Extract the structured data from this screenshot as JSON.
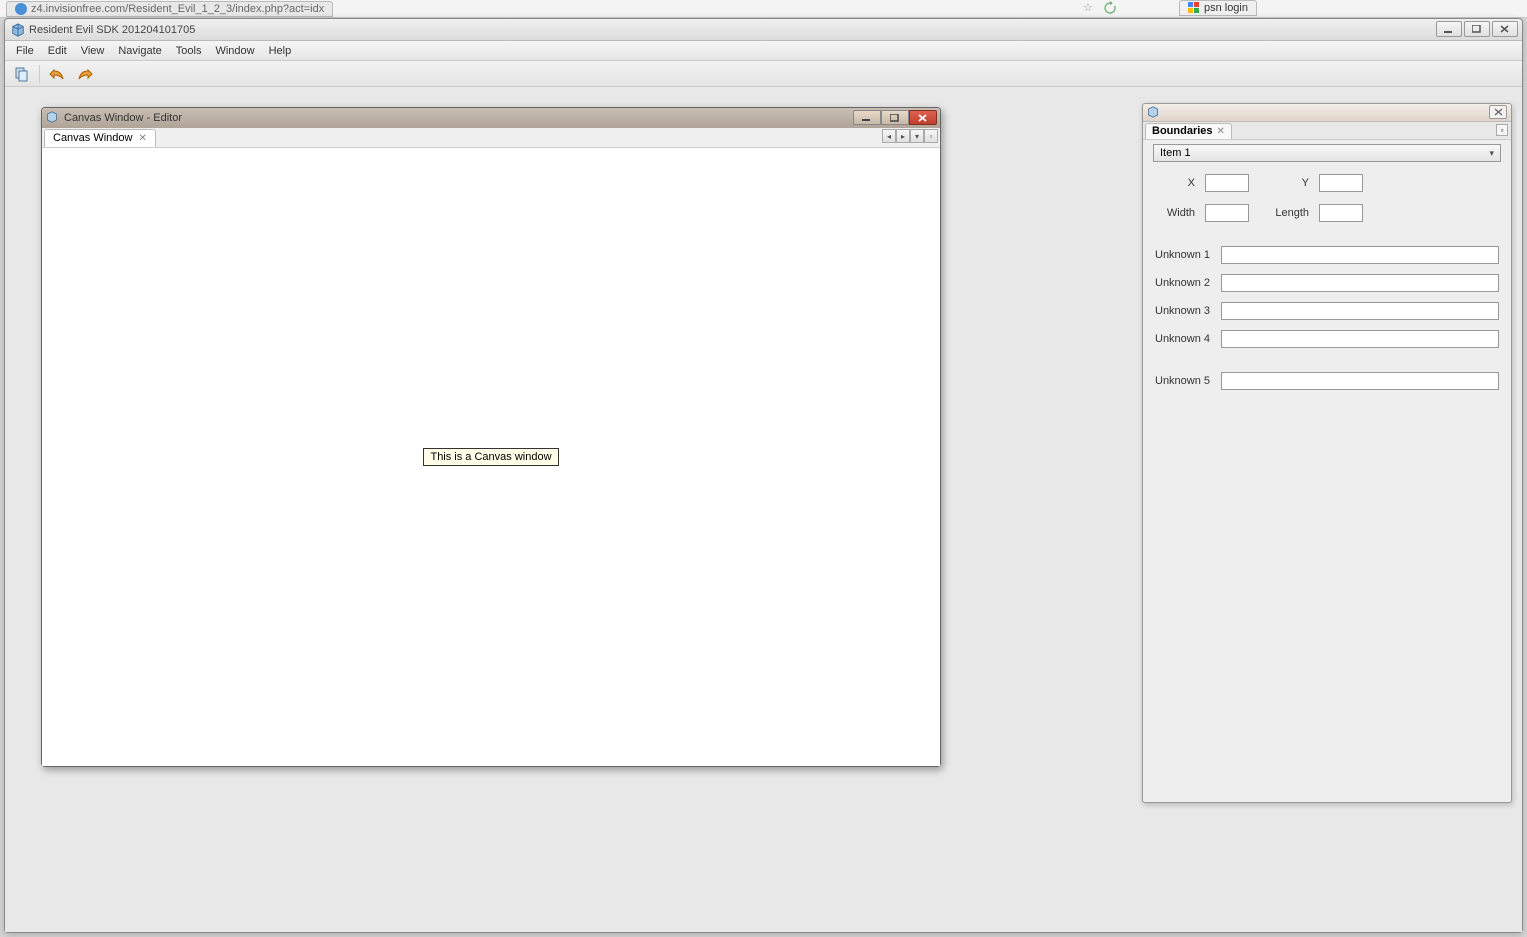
{
  "browser": {
    "left_tab_text": "z4.invisionfree.com/Resident_Evil_1_2_3/index.php?act=idx",
    "right_tab_text": "psn login"
  },
  "app": {
    "title": "Resident Evil SDK 201204101705",
    "menus": [
      "File",
      "Edit",
      "View",
      "Navigate",
      "Tools",
      "Window",
      "Help"
    ]
  },
  "canvas_window": {
    "title": "Canvas Window - Editor",
    "tab_label": "Canvas Window",
    "center_text": "This is a Canvas window"
  },
  "boundaries_panel": {
    "tab_label": "Boundaries",
    "dropdown_selected": "Item 1",
    "pos_labels": {
      "x": "X",
      "y": "Y",
      "width": "Width",
      "length": "Length"
    },
    "pos_values": {
      "x": "",
      "y": "",
      "width": "",
      "length": ""
    },
    "unknown_rows": [
      {
        "label": "Unknown 1",
        "value": ""
      },
      {
        "label": "Unknown 2",
        "value": ""
      },
      {
        "label": "Unknown 3",
        "value": ""
      },
      {
        "label": "Unknown 4",
        "value": ""
      },
      {
        "label": "Unknown 5",
        "value": ""
      }
    ]
  }
}
